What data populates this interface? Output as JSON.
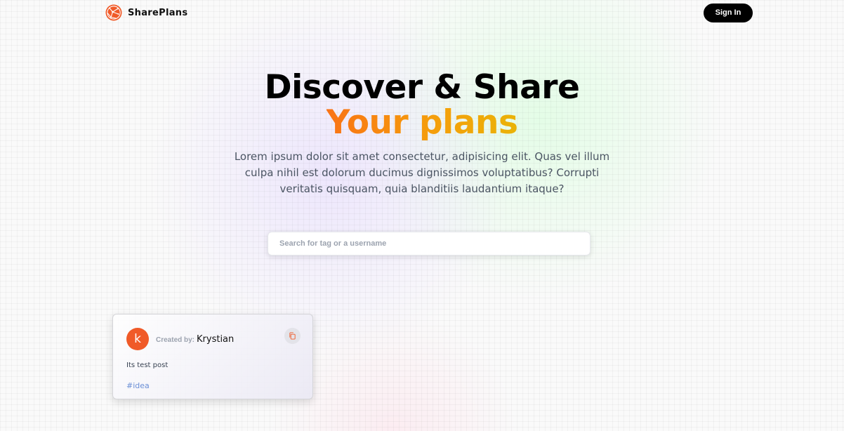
{
  "brand": {
    "name": "SharePlans",
    "logo_icon": "globe-network-icon",
    "logo_color": "#f05a28"
  },
  "nav": {
    "signin_label": "Sign In"
  },
  "hero": {
    "title_line1": "Discover & Share",
    "title_line2": "Your plans",
    "accent_gradient": [
      "#f97316",
      "#f59e0b",
      "#eab308"
    ],
    "description": "Lorem ipsum dolor sit amet consectetur, adipisicing elit. Quas vel illum culpa nihil est dolorum ducimus dignissimos voluptatibus? Corrupti veritatis quisquam, quia blanditiis laudantium itaque?"
  },
  "search": {
    "placeholder": "Search for tag or a username",
    "value": ""
  },
  "posts": [
    {
      "avatar_letter": "k",
      "avatar_color": "#f05a28",
      "created_by_label": "Created by:",
      "username": "Krystian",
      "text": "Its test post",
      "tag": "#idea",
      "copy_icon": "copy-icon"
    }
  ]
}
